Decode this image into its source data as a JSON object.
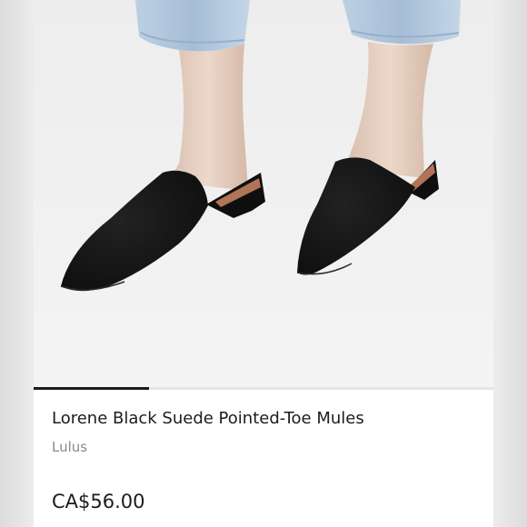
{
  "product": {
    "image_alt": "Black suede pointed-toe mules worn with light wash jeans",
    "carousel_progress": 0.25,
    "title": "Lorene Black Suede Pointed-Toe Mules",
    "brand": "Lulus",
    "price": "CA$56.00"
  },
  "colors": {
    "background": "#f0f0f0",
    "card": "#ffffff",
    "shoe": "#141414",
    "denim": "#a9c1d9",
    "text_primary": "#1c1c1c",
    "text_secondary": "#8a8a8a",
    "carousel_indicator": "#1a1a1a"
  }
}
